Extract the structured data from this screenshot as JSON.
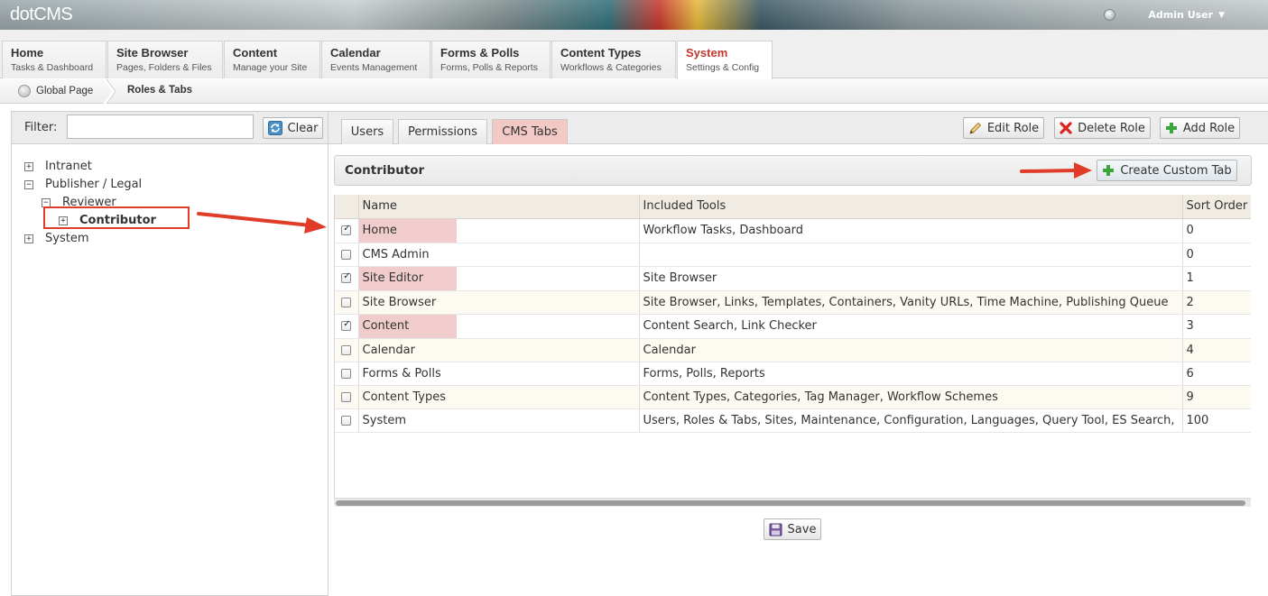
{
  "header": {
    "logo": "dotCMS",
    "user_name": "Admin User"
  },
  "main_nav": [
    {
      "title": "Home",
      "subtitle": "Tasks & Dashboard"
    },
    {
      "title": "Site Browser",
      "subtitle": "Pages, Folders & Files"
    },
    {
      "title": "Content",
      "subtitle": "Manage your Site"
    },
    {
      "title": "Calendar",
      "subtitle": "Events Management"
    },
    {
      "title": "Forms & Polls",
      "subtitle": "Forms, Polls & Reports"
    },
    {
      "title": "Content Types",
      "subtitle": "Workflows & Categories"
    },
    {
      "title": "System",
      "subtitle": "Settings & Config",
      "active": true
    }
  ],
  "breadcrumb": {
    "home": "Global Page",
    "current": "Roles & Tabs"
  },
  "filter": {
    "label": "Filter:",
    "value": "",
    "clear_label": "Clear"
  },
  "role_tree": [
    {
      "label": "Intranet",
      "toggle": "+"
    },
    {
      "label": "Publisher / Legal",
      "toggle": "−"
    },
    {
      "label": "Reviewer",
      "toggle": "−"
    },
    {
      "label": "Contributor",
      "toggle": "+",
      "selected": true
    },
    {
      "label": "System",
      "toggle": "+"
    }
  ],
  "sub_tabs": [
    {
      "label": "Users"
    },
    {
      "label": "Permissions"
    },
    {
      "label": "CMS Tabs",
      "active": true
    }
  ],
  "role_actions": {
    "edit": "Edit Role",
    "delete": "Delete Role",
    "add": "Add Role"
  },
  "role_panel": {
    "title": "Contributor",
    "create_tab_label": "Create Custom Tab"
  },
  "table": {
    "columns": [
      "Name",
      "Included Tools",
      "Sort Order"
    ],
    "rows": [
      {
        "checked": true,
        "name": "Home",
        "tools": "Workflow Tasks, Dashboard",
        "sort": "0"
      },
      {
        "checked": false,
        "name": "CMS Admin",
        "tools": "",
        "sort": "0"
      },
      {
        "checked": true,
        "name": "Site Editor",
        "tools": "Site Browser",
        "sort": "1"
      },
      {
        "checked": false,
        "name": "Site Browser",
        "tools": "Site Browser, Links, Templates, Containers, Vanity URLs, Time Machine, Publishing Queue",
        "sort": "2"
      },
      {
        "checked": true,
        "name": "Content",
        "tools": "Content Search, Link Checker",
        "sort": "3"
      },
      {
        "checked": false,
        "name": "Calendar",
        "tools": "Calendar",
        "sort": "4"
      },
      {
        "checked": false,
        "name": "Forms & Polls",
        "tools": "Forms, Polls, Reports",
        "sort": "6"
      },
      {
        "checked": false,
        "name": "Content Types",
        "tools": "Content Types, Categories, Tag Manager, Workflow Schemes",
        "sort": "9"
      },
      {
        "checked": false,
        "name": "System",
        "tools": "Users, Roles & Tabs, Sites, Maintenance, Configuration, Languages, Query Tool, ES Search,",
        "sort": "100"
      }
    ]
  },
  "save_label": "Save",
  "colors": {
    "active_nav": "#c0392b",
    "highlight": "#f0cccc",
    "annotation_red": "#e03c28"
  },
  "icons": {
    "clear": "refresh-icon",
    "edit": "pencil-icon",
    "delete": "red-x-icon",
    "add": "green-plus-icon",
    "save": "floppy-disk-icon"
  }
}
